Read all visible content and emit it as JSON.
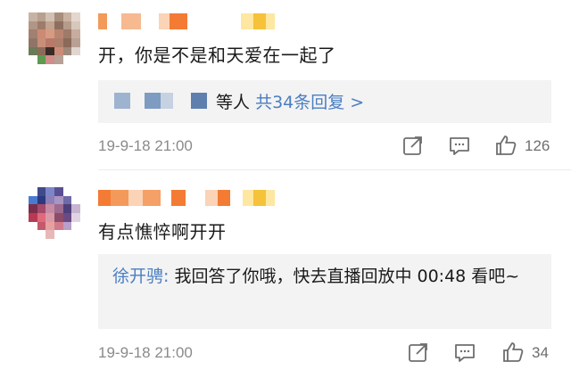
{
  "comments": [
    {
      "text": "开，你是不是和天爱在一起了",
      "reply_summary": {
        "suffix": "等人",
        "link": "共34条回复 >"
      },
      "date": "19-9-18 21:00",
      "likes": "126"
    },
    {
      "text": "有点憔悴啊开开",
      "reply": {
        "author": "徐开骋:",
        "text": "我回答了你哦，快去直播回放中 00:48 看吧~"
      },
      "date": "19-9-18 21:00",
      "likes": "34"
    }
  ],
  "icons": {
    "share": "share-icon",
    "reply": "reply-icon",
    "like": "thumbs-up-icon"
  },
  "colors": {
    "link": "#4a7ec1",
    "meta_text": "#8a8a8a",
    "reply_bg": "#f3f3f3"
  }
}
